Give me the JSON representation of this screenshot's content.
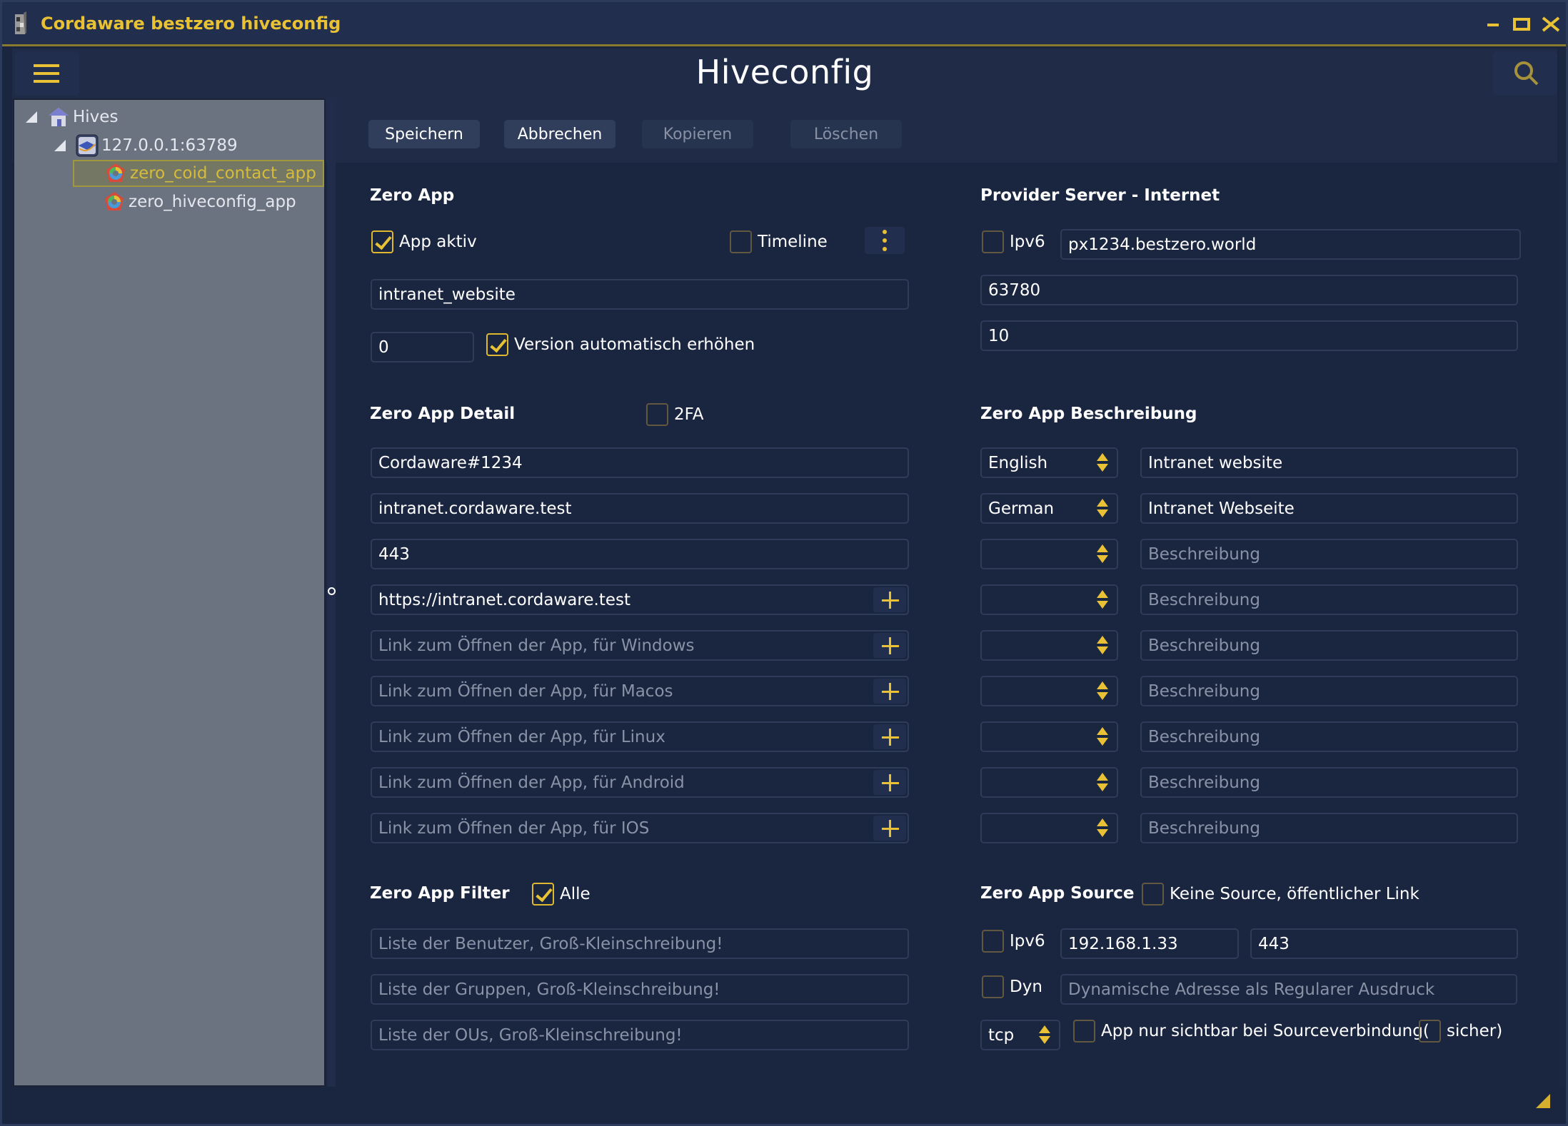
{
  "window": {
    "title": "Cordaware bestzero hiveconfig",
    "controls": [
      "minimize",
      "maximize",
      "close"
    ]
  },
  "header": {
    "title": "Hiveconfig",
    "menu_icon": "hamburger-menu-icon",
    "search_icon": "search-icon"
  },
  "toolbar": {
    "save": "Speichern",
    "cancel": "Abbrechen",
    "copy": "Kopieren",
    "delete": "Löschen"
  },
  "tree": {
    "root": "Hives",
    "server": "127.0.0.1:63789",
    "apps": [
      {
        "label": "zero_coid_contact_app",
        "selected": true
      },
      {
        "label": "zero_hiveconfig_app",
        "selected": false
      }
    ]
  },
  "zero_app": {
    "title": "Zero App",
    "app_aktiv": {
      "label": "App aktiv",
      "checked": true
    },
    "timeline": {
      "label": "Timeline",
      "checked": false
    },
    "name": "intranet_website",
    "version": "0",
    "version_auto": {
      "label": "Version automatisch erhöhen",
      "checked": true
    }
  },
  "provider": {
    "title": "Provider Server - Internet",
    "ipv6": {
      "label": "Ipv6",
      "checked": false
    },
    "host": "px1234.bestzero.world",
    "port": "63780",
    "value3": "10"
  },
  "detail": {
    "title": "Zero App Detail",
    "twofa": {
      "label": "2FA",
      "checked": false
    },
    "owner": "Cordaware#1234",
    "host": "intranet.cordaware.test",
    "port": "443",
    "url": "https://intranet.cordaware.test",
    "links": [
      {
        "value": "",
        "placeholder": "Link zum Öffnen der App, für Windows"
      },
      {
        "value": "",
        "placeholder": "Link zum Öffnen der App, für Macos"
      },
      {
        "value": "",
        "placeholder": "Link zum Öffnen der App, für Linux"
      },
      {
        "value": "",
        "placeholder": "Link zum Öffnen der App, für Android"
      },
      {
        "value": "",
        "placeholder": "Link zum Öffnen der App, für IOS"
      }
    ]
  },
  "beschreibung": {
    "title": "Zero App Beschreibung",
    "rows": [
      {
        "language": "English",
        "text": "Intranet website",
        "placeholder": "Beschreibung"
      },
      {
        "language": "German",
        "text": "Intranet Webseite",
        "placeholder": "Beschreibung"
      },
      {
        "language": "",
        "text": "",
        "placeholder": "Beschreibung"
      },
      {
        "language": "",
        "text": "",
        "placeholder": "Beschreibung"
      },
      {
        "language": "",
        "text": "",
        "placeholder": "Beschreibung"
      },
      {
        "language": "",
        "text": "",
        "placeholder": "Beschreibung"
      },
      {
        "language": "",
        "text": "",
        "placeholder": "Beschreibung"
      },
      {
        "language": "",
        "text": "",
        "placeholder": "Beschreibung"
      },
      {
        "language": "",
        "text": "",
        "placeholder": "Beschreibung"
      }
    ]
  },
  "filter": {
    "title": "Zero App Filter",
    "alle": {
      "label": "Alle",
      "checked": true
    },
    "users_placeholder": "Liste der Benutzer, Groß-Kleinschreibung!",
    "groups_placeholder": "Liste der Gruppen, Groß-Kleinschreibung!",
    "ous_placeholder": "Liste der OUs, Groß-Kleinschreibung!"
  },
  "source": {
    "title": "Zero App Source",
    "no_source": {
      "label": "Keine Source, öffentlicher Link",
      "checked": false
    },
    "ipv6": {
      "label": "Ipv6",
      "checked": false
    },
    "address": "192.168.1.33",
    "port": "443",
    "dyn": {
      "label": "Dyn",
      "checked": false
    },
    "dyn_placeholder": "Dynamische Adresse als Regularer Ausdruck",
    "protocol": "tcp",
    "visible_only": {
      "label": "App nur sichtbar bei Sourceverbindung(",
      "checked": false
    },
    "secure": {
      "label": "sicher)",
      "checked": false
    }
  },
  "colors": {
    "accent": "#e8c234",
    "background": "#1a2540",
    "titlebar": "#222e4e",
    "tree_background": "#6b7280"
  }
}
